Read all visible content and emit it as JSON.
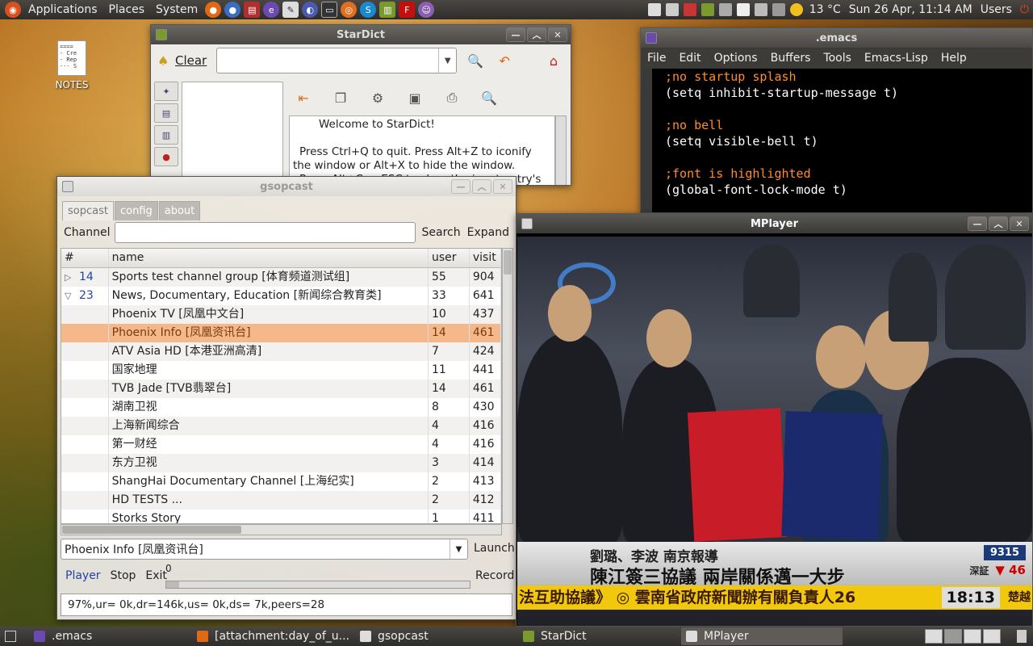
{
  "top_panel": {
    "menus": [
      "Applications",
      "Places",
      "System"
    ],
    "weather": "13 °C",
    "clock": "Sun 26 Apr, 11:14 AM",
    "user": "Users"
  },
  "desktop": {
    "icon_label": "NOTES",
    "icon_lines": [
      "====",
      "- Cre",
      "- Rep",
      "--- S"
    ]
  },
  "emacs": {
    "title": ".emacs",
    "menus": [
      "File",
      "Edit",
      "Options",
      "Buffers",
      "Tools",
      "Emacs-Lisp",
      "Help"
    ],
    "lines": [
      {
        "t": ";no startup splash",
        "c": true
      },
      {
        "t": "(setq inhibit-startup-message t)",
        "c": false
      },
      {
        "t": "",
        "c": false
      },
      {
        "t": ";no bell",
        "c": true
      },
      {
        "t": "(setq visible-bell t)",
        "c": false
      },
      {
        "t": "",
        "c": false
      },
      {
        "t": ";font is highlighted",
        "c": true
      },
      {
        "t": "(global-font-lock-mode t)",
        "c": false
      }
    ]
  },
  "stardict": {
    "title": "StarDict",
    "clear_label": "Clear",
    "text": [
      "Welcome to StarDict!",
      "Press Ctrl+Q to quit. Press Alt+Z to iconify the window or Alt+X to hide the window.",
      "Press Alt+C or ESC to clear the input entry's text."
    ]
  },
  "gsopcast": {
    "title": "gsopcast",
    "tabs": [
      "sopcast",
      "config",
      "about"
    ],
    "channel_label": "Channel",
    "search_label": "Search",
    "expand_label": "Expand",
    "columns": [
      "#",
      "name",
      "user",
      "visit"
    ],
    "rows": [
      {
        "id": "14",
        "exp": "▷",
        "name": "Sports test channel group [体育频道测试组]",
        "user": "55",
        "visit": "904"
      },
      {
        "id": "23",
        "exp": "▽",
        "name": "News, Documentary, Education [新闻综合教育类]",
        "user": "33",
        "visit": "641"
      },
      {
        "id": "",
        "exp": "",
        "name": "Phoenix TV [凤凰中文台]",
        "user": "10",
        "visit": "437"
      },
      {
        "id": "",
        "exp": "",
        "name": "Phoenix Info [凤凰资讯台]",
        "user": "14",
        "visit": "461",
        "selected": true
      },
      {
        "id": "",
        "exp": "",
        "name": "ATV Asia HD [本港亚洲高清]",
        "user": "7",
        "visit": "424"
      },
      {
        "id": "",
        "exp": "",
        "name": "国家地理",
        "user": "11",
        "visit": "441"
      },
      {
        "id": "",
        "exp": "",
        "name": "TVB Jade [TVB翡翠台]",
        "user": "14",
        "visit": "461"
      },
      {
        "id": "",
        "exp": "",
        "name": "湖南卫视",
        "user": "8",
        "visit": "430"
      },
      {
        "id": "",
        "exp": "",
        "name": "上海新闻综合",
        "user": "4",
        "visit": "416"
      },
      {
        "id": "",
        "exp": "",
        "name": "第一财经",
        "user": "4",
        "visit": "416"
      },
      {
        "id": "",
        "exp": "",
        "name": "东方卫视",
        "user": "3",
        "visit": "414"
      },
      {
        "id": "",
        "exp": "",
        "name": "ShangHai Documentary Channel [上海纪实]",
        "user": "2",
        "visit": "413"
      },
      {
        "id": "",
        "exp": "",
        "name": "HD TESTS ...",
        "user": "2",
        "visit": "412"
      },
      {
        "id": "",
        "exp": "",
        "name": "Storks Story",
        "user": "1",
        "visit": "411"
      }
    ],
    "combo_value": "Phoenix Info [凤凰资讯台]",
    "launch_label": "Launch",
    "player_label": "Player",
    "stop_label": "Stop",
    "exit_label": "Exit",
    "volume": "0",
    "record_label": "Record",
    "status": "97%,ur= 0k,dr=146k,us= 0k,ds= 7k,peers=28"
  },
  "mplayer": {
    "title": "MPlayer",
    "ticker_top": "劉璐、李波 南京報導",
    "ticker_main": "陳江簽三協議 兩岸關係邁一大步",
    "ticker_bottom": "法互助協議》 ◎ 雲南省政府新聞辦有關負責人26",
    "stock_label": "9315",
    "stock_change": "▼ 46",
    "stock_name": "深証",
    "clock": "18:13",
    "clock_side": "楚越"
  },
  "taskbar": [
    {
      "label": ".emacs",
      "active": false
    },
    {
      "label": "[attachment:day_of_u...",
      "active": false
    },
    {
      "label": "gsopcast",
      "active": false
    },
    {
      "label": "StarDict",
      "active": false
    },
    {
      "label": "MPlayer",
      "active": true
    }
  ]
}
